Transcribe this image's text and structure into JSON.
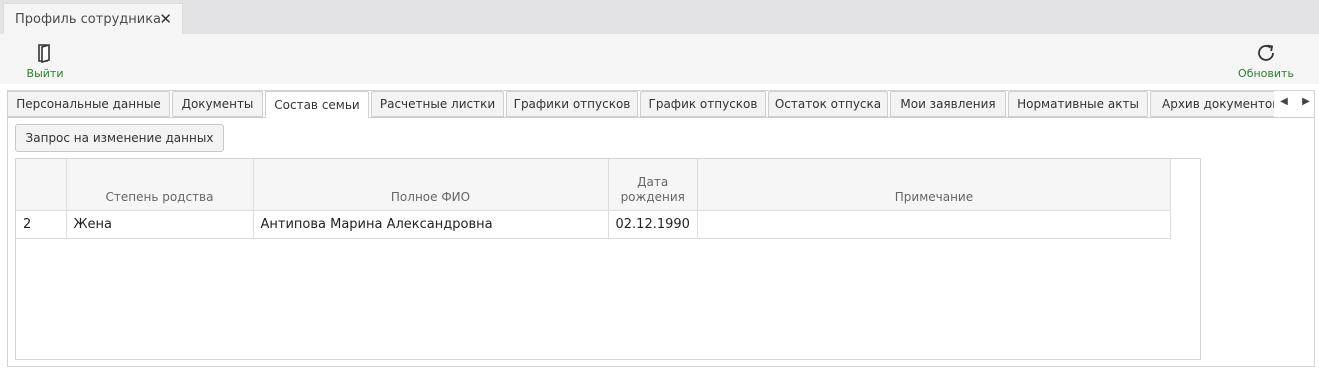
{
  "window": {
    "tab_title": "Профиль сотрудника",
    "close_symbol": "✕"
  },
  "toolbar": {
    "exit_label": "Выйти",
    "refresh_label": "Обновить",
    "accent_color": "#2e7d32",
    "exit_icon": "door-exit-icon",
    "refresh_icon": "refresh-icon"
  },
  "tabs": [
    {
      "label": "Персональные данные"
    },
    {
      "label": "Документы"
    },
    {
      "label": "Состав семьи",
      "active": true
    },
    {
      "label": "Расчетные листки"
    },
    {
      "label": "Графики отпусков"
    },
    {
      "label": "График отпусков"
    },
    {
      "label": "Остаток отпуска"
    },
    {
      "label": "Мои заявления"
    },
    {
      "label": "Нормативные акты"
    },
    {
      "label": "Архив документов"
    }
  ],
  "tab_scroll": {
    "left": "◀",
    "right": "▶"
  },
  "request_button_label": "Запрос на изменение данных",
  "table": {
    "columns": [
      "",
      "Степень родства",
      "Полное ФИО",
      "Дата рождения",
      "Примечание"
    ],
    "date_col_line1": "Дата",
    "date_col_line2": "рождения",
    "rows": [
      {
        "num": "2",
        "relation": "Жена",
        "name": "Антипова Марина Александровна",
        "birth": "02.12.1990",
        "note": ""
      }
    ]
  }
}
